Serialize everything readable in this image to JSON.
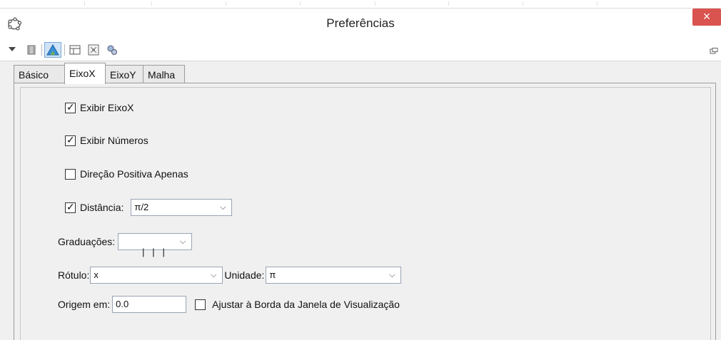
{
  "window": {
    "title": "Preferências",
    "close_label": "×"
  },
  "toolbar": {
    "icons": [
      "menu-triangle-icon",
      "graphics-icon",
      "graphics-active-icon",
      "layout-icon",
      "algebra-icon",
      "advanced-settings-icon"
    ],
    "active": "graphics-active-icon"
  },
  "tabs": [
    {
      "label": "Básico"
    },
    {
      "label": "EixoX",
      "selected": true
    },
    {
      "label": "EixoY"
    },
    {
      "label": "Malha"
    }
  ],
  "options": {
    "show_axis": {
      "label": "Exibir EixoX",
      "checked": true
    },
    "show_numbers": {
      "label": "Exibir Números",
      "checked": true
    },
    "positive_only": {
      "label": "Direção Positiva Apenas",
      "checked": false
    },
    "distance": {
      "label": "Distância:",
      "checked": true,
      "value": "π/2"
    },
    "ticks": {
      "label": "Graduações:",
      "value": "|   |   |"
    },
    "label": {
      "label": "Rótulo:",
      "value": "x"
    },
    "unit": {
      "label": "Unidade:",
      "value": "π"
    },
    "origin": {
      "label": "Origem em:",
      "value": "0.0"
    },
    "snap_border": {
      "label": "Ajustar à Borda da Janela de Visualização",
      "checked": false
    }
  },
  "colors": {
    "close": "#d9534f",
    "active_tool": "#cfe3f7"
  }
}
